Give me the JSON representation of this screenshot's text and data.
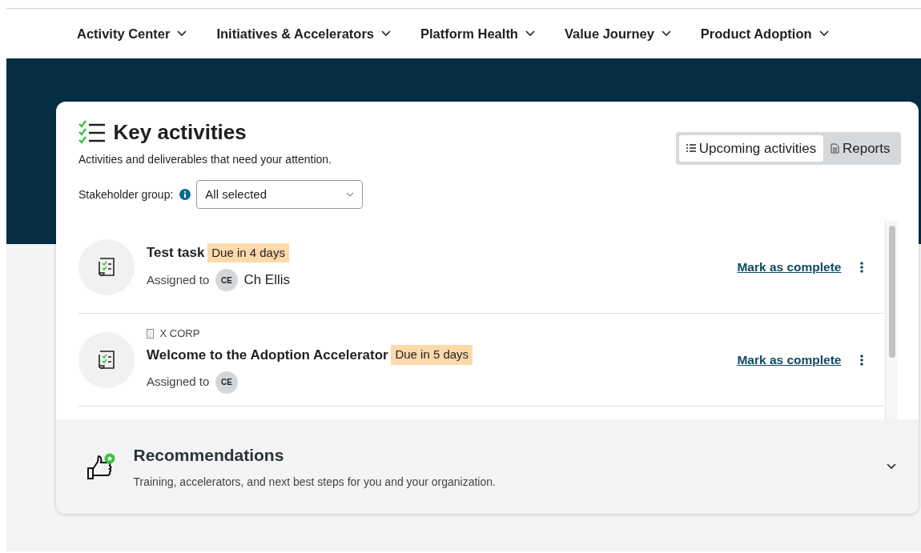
{
  "nav": [
    {
      "label": "Activity Center"
    },
    {
      "label": "Initiatives & Accelerators"
    },
    {
      "label": "Platform Health"
    },
    {
      "label": "Value Journey"
    },
    {
      "label": "Product Adoption"
    }
  ],
  "key_activities": {
    "title": "Key activities",
    "subtitle": "Activities and deliverables that need your attention.",
    "filter": {
      "label": "Stakeholder group:",
      "value": "All selected"
    },
    "tabs": [
      {
        "label": "Upcoming activities",
        "selected": true,
        "kind": "list"
      },
      {
        "label": "Reports",
        "selected": false,
        "kind": "report"
      }
    ],
    "tasks": [
      {
        "title": "Test task",
        "due": "Due in 4 days",
        "assigned_label": "Assigned to",
        "initials": "CE",
        "assignee": "Ch Ellis",
        "action": "Mark as complete"
      },
      {
        "org": "X CORP",
        "title": "Welcome to the Adoption Accelerator",
        "due": "Due in 5 days",
        "assigned_label": "Assigned to",
        "initials": "CE",
        "action": "Mark as complete"
      }
    ]
  },
  "recommendations": {
    "title": "Recommendations",
    "subtitle": "Training, accelerators, and next best steps for you and your organization.",
    "expanded": false
  }
}
